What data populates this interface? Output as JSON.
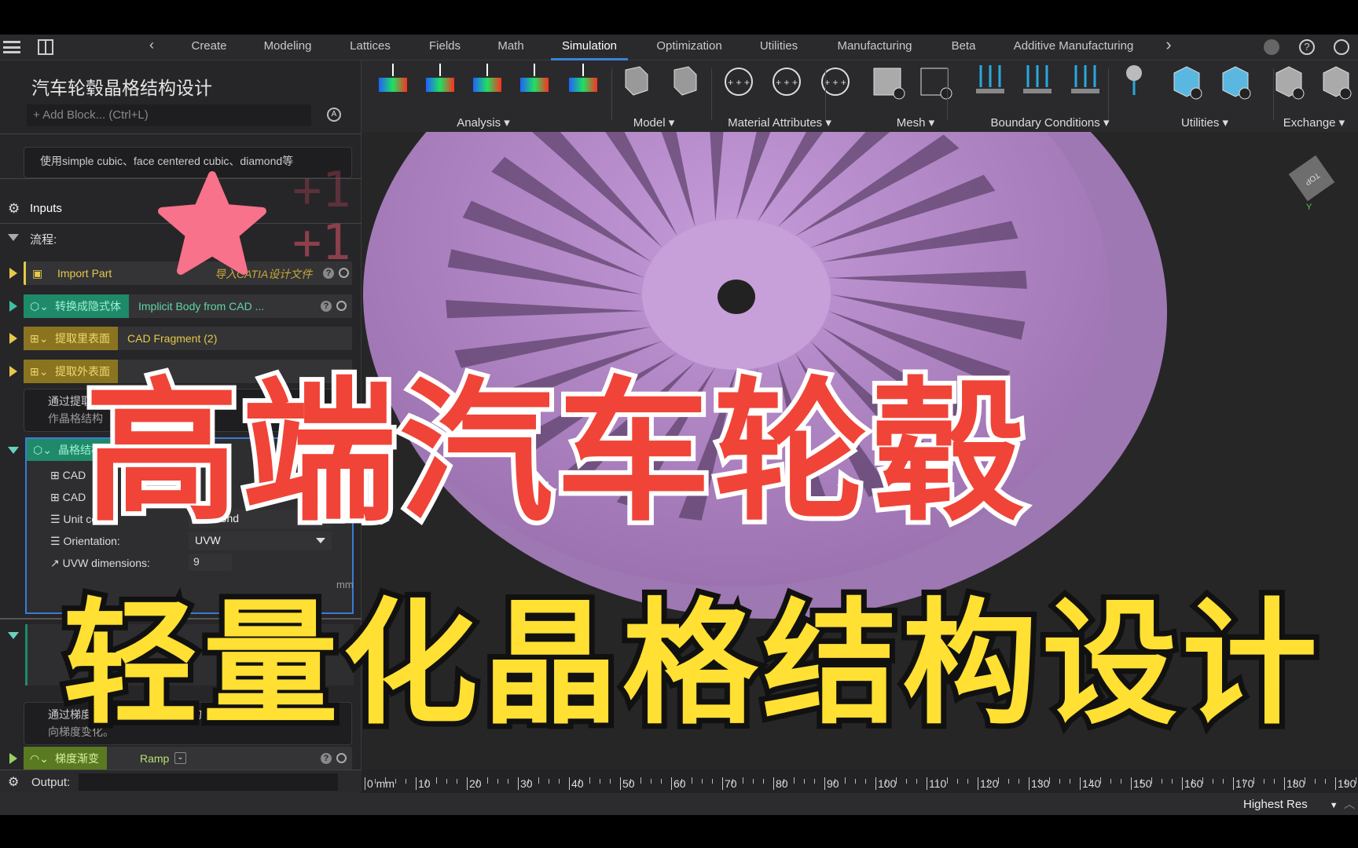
{
  "tabs": {
    "items": [
      "Create",
      "Modeling",
      "Lattices",
      "Fields",
      "Math",
      "Simulation",
      "Optimization",
      "Utilities",
      "Manufacturing",
      "Beta",
      "Additive Manufacturing"
    ],
    "active": "Simulation"
  },
  "ribbon": {
    "groups": [
      "Analysis",
      "Model",
      "Material Attributes",
      "Mesh",
      "Boundary Conditions",
      "Utilities",
      "Exchange"
    ],
    "accent": "#29a8e0"
  },
  "left": {
    "title": "汽车轮毂晶格结构设计",
    "add_block_placeholder": "Add Block... (Ctrl+L)",
    "desc1": "使用simple cubic、face centered cubic、diamond等",
    "inputs_label": "Inputs",
    "flow_label": "流程:",
    "blocks": [
      {
        "tag": "Import Part",
        "note": "导入CATIA设计文件",
        "color": "#e6c84a"
      },
      {
        "tag": "转换成隐式体",
        "value": "Implicit Body from CAD ...",
        "color": "#1f8a6a"
      },
      {
        "tag": "提取里表面",
        "value": "CAD Fragment (2)",
        "color": "#8a7420"
      },
      {
        "tag": "提取外表面",
        "color": "#8a7420"
      }
    ],
    "desc2_line1": "通过提取的表面作为Conformal",
    "desc2_line2": "作晶格结构",
    "lattice": {
      "tag": "晶格结构",
      "rows": [
        "CAD",
        "CAD"
      ],
      "unit_cell_label": "Unit cell:",
      "unit_cell_value": "Diamond",
      "orientation_label": "Orientation:",
      "orientation_value": "UVW",
      "uvw_label": "UVW dimensions:",
      "uvw_value": "9",
      "unit": "mm"
    },
    "desc3_line1": "通过梯度渐变函数实现晶格结构的粗细沿着某个方",
    "desc3_line2": "向梯度变化。",
    "ramp": {
      "tag": "梯度渐变",
      "value": "Ramp"
    },
    "output_label": "Output:"
  },
  "viewcube": {
    "face": "TOP",
    "axis_y": "Y"
  },
  "ruler": {
    "ticks": [
      "0 mm",
      "10",
      "20",
      "30",
      "40",
      "50",
      "60",
      "70",
      "80",
      "90",
      "100",
      "110",
      "120",
      "130",
      "140",
      "150",
      "160",
      "170",
      "180",
      "190"
    ]
  },
  "status": {
    "resolution": "Highest Res"
  },
  "overlay": {
    "headline": "高端汽车轮毂",
    "subline": "轻量化晶格结构设计",
    "plus1": "+1",
    "plus2": "+1",
    "headline_color": "#f04438",
    "subline_color": "#ffe033",
    "star_color": "#f7728a"
  }
}
